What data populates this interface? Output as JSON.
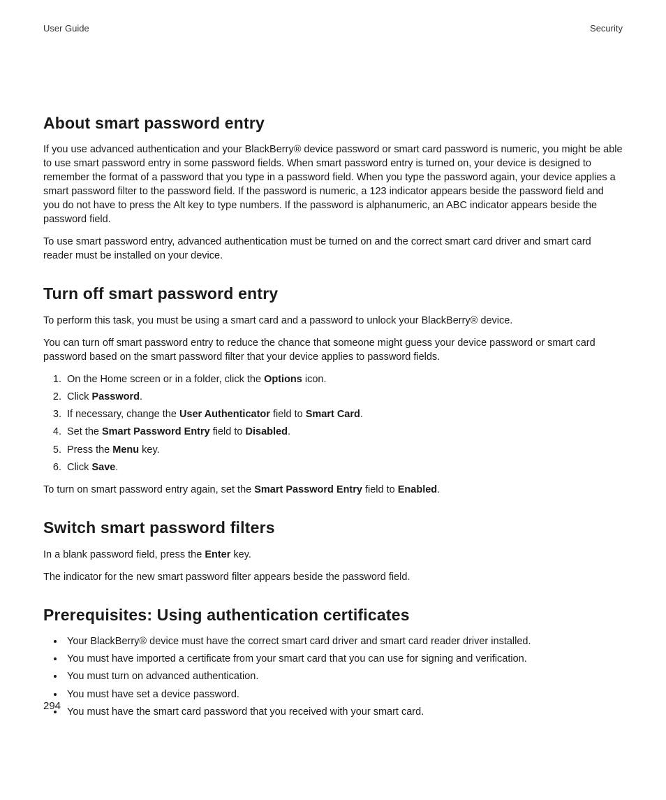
{
  "header": {
    "left": "User Guide",
    "right": "Security"
  },
  "page_number": "294",
  "sections": {
    "s1": {
      "title": "About smart password entry",
      "p1": "If you use advanced authentication and your BlackBerry® device password or smart card password is numeric, you might be able to use smart password entry in some password fields. When smart password entry is turned on, your device is designed to remember the format of a password that you type in a password field. When you type the password again, your device applies a smart password filter to the password field. If the password is numeric, a 123 indicator appears beside the password field and you do not have to press the Alt key to type numbers. If the password is alphanumeric, an ABC indicator appears beside the password field.",
      "p2": "To use smart password entry, advanced authentication must be turned on and the correct smart card driver and smart card reader must be installed on your device."
    },
    "s2": {
      "title": "Turn off smart password entry",
      "p1": "To perform this task, you must be using a smart card and a password to unlock your BlackBerry® device.",
      "p2": "You can turn off smart password entry to reduce the chance that someone might guess your device password or smart card password based on the smart password filter that your device applies to password fields.",
      "li1_a": "On the Home screen or in a folder, click the ",
      "li1_b": "Options",
      "li1_c": " icon.",
      "li2_a": "Click ",
      "li2_b": "Password",
      "li2_c": ".",
      "li3_a": "If necessary, change the ",
      "li3_b": "User Authenticator",
      "li3_c": " field to ",
      "li3_d": "Smart Card",
      "li3_e": ".",
      "li4_a": "Set the ",
      "li4_b": "Smart Password Entry",
      "li4_c": " field to ",
      "li4_d": "Disabled",
      "li4_e": ".",
      "li5_a": "Press the ",
      "li5_b": "Menu",
      "li5_c": " key.",
      "li6_a": "Click ",
      "li6_b": "Save",
      "li6_c": ".",
      "p3_a": "To turn on smart password entry again, set the ",
      "p3_b": "Smart Password Entry",
      "p3_c": " field to ",
      "p3_d": "Enabled",
      "p3_e": "."
    },
    "s3": {
      "title": "Switch smart password filters",
      "p1_a": "In a blank password field, press the ",
      "p1_b": "Enter",
      "p1_c": " key.",
      "p2": "The indicator for the new smart password filter appears beside the password field."
    },
    "s4": {
      "title": "Prerequisites: Using authentication certificates",
      "li1": "Your BlackBerry® device must have the correct smart card driver and smart card reader driver installed.",
      "li2": "You must have imported a certificate from your smart card that you can use for signing and verification.",
      "li3": "You must turn on advanced authentication.",
      "li4": "You must have set a device password.",
      "li5": "You must have the smart card password that you received with your smart card."
    }
  }
}
